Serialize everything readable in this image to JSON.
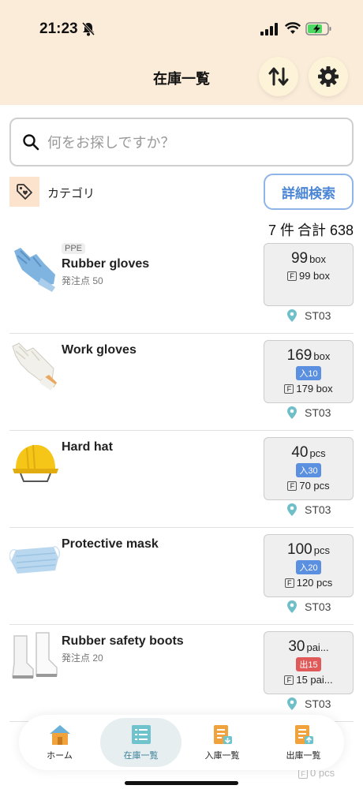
{
  "status_bar": {
    "time": "21:23"
  },
  "header": {
    "title": "在庫一覧"
  },
  "search": {
    "placeholder": "何をお探しですか？"
  },
  "filter": {
    "category_label": "カテゴリ",
    "advanced_button": "詳細検索"
  },
  "summary": {
    "count": "7 件",
    "total": "合計 638"
  },
  "items": [
    {
      "category": "PPE",
      "name": "Rubber gloves",
      "reorder": "発注点 50",
      "qty": "99",
      "unit": "box",
      "movement": "",
      "forecast": "99 box",
      "location": "ST03"
    },
    {
      "category": "",
      "name": "Work gloves",
      "reorder": "",
      "qty": "169",
      "unit": "box",
      "movement": "入10",
      "forecast": "179 box",
      "location": "ST03"
    },
    {
      "category": "",
      "name": "Hard hat",
      "reorder": "",
      "qty": "40",
      "unit": "pcs",
      "movement": "入30",
      "forecast": "70 pcs",
      "location": "ST03"
    },
    {
      "category": "",
      "name": "Protective mask",
      "reorder": "",
      "qty": "100",
      "unit": "pcs",
      "movement": "入20",
      "forecast": "120 pcs",
      "location": "ST03"
    },
    {
      "category": "",
      "name": "Rubber safety boots",
      "reorder": "発注点 20",
      "qty": "30",
      "unit": "pai...",
      "movement": "出15",
      "forecast": "15 pai...",
      "location": "ST03"
    }
  ],
  "partial_row": {
    "forecast": "0 pcs"
  },
  "tabs": [
    {
      "label": "ホーム"
    },
    {
      "label": "在庫一覧"
    },
    {
      "label": "入庫一覧"
    },
    {
      "label": "出庫一覧"
    }
  ],
  "colors": {
    "header_bg": "#fbebd9",
    "accent_blue": "#4b86d6",
    "in_badge": "#5b8fe0",
    "out_badge": "#e05a5a",
    "active_tab": "#3b7f98"
  }
}
